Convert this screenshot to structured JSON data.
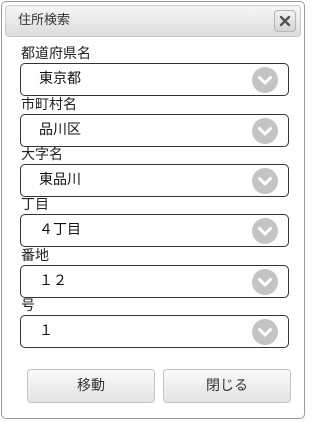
{
  "dialog": {
    "title": "住所検索",
    "close_icon": "close-x-icon"
  },
  "fields": [
    {
      "label": "都道府県名",
      "value": "東京都"
    },
    {
      "label": "市町村名",
      "value": "品川区"
    },
    {
      "label": "大字名",
      "value": "東品川"
    },
    {
      "label": "丁目",
      "value": "４丁目"
    },
    {
      "label": "番地",
      "value": "１２"
    },
    {
      "label": "号",
      "value": "１"
    }
  ],
  "buttons": {
    "move_label": "移動",
    "close_label": "閉じる"
  },
  "colors": {
    "chevron_circle": "#c4c4c4",
    "select_border": "#333333"
  }
}
